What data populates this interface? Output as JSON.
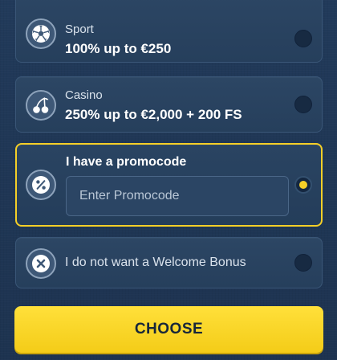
{
  "options": [
    {
      "label": "Sport",
      "title": "100% up to €250",
      "icon": "soccer-ball-icon",
      "selected": false
    },
    {
      "label": "Casino",
      "title": "250% up to €2,000 + 200 FS",
      "icon": "cherries-icon",
      "selected": false
    },
    {
      "title": "I have a promocode",
      "icon": "percent-icon",
      "input_placeholder": "Enter Promocode",
      "input_value": "",
      "selected": true
    },
    {
      "label": "I do not want a Welcome Bonus",
      "icon": "close-icon",
      "selected": false
    }
  ],
  "choose_button": {
    "label": "CHOOSE"
  },
  "colors": {
    "accent": "#f5cf27",
    "background": "#1f3553",
    "card": "#2a4462"
  }
}
